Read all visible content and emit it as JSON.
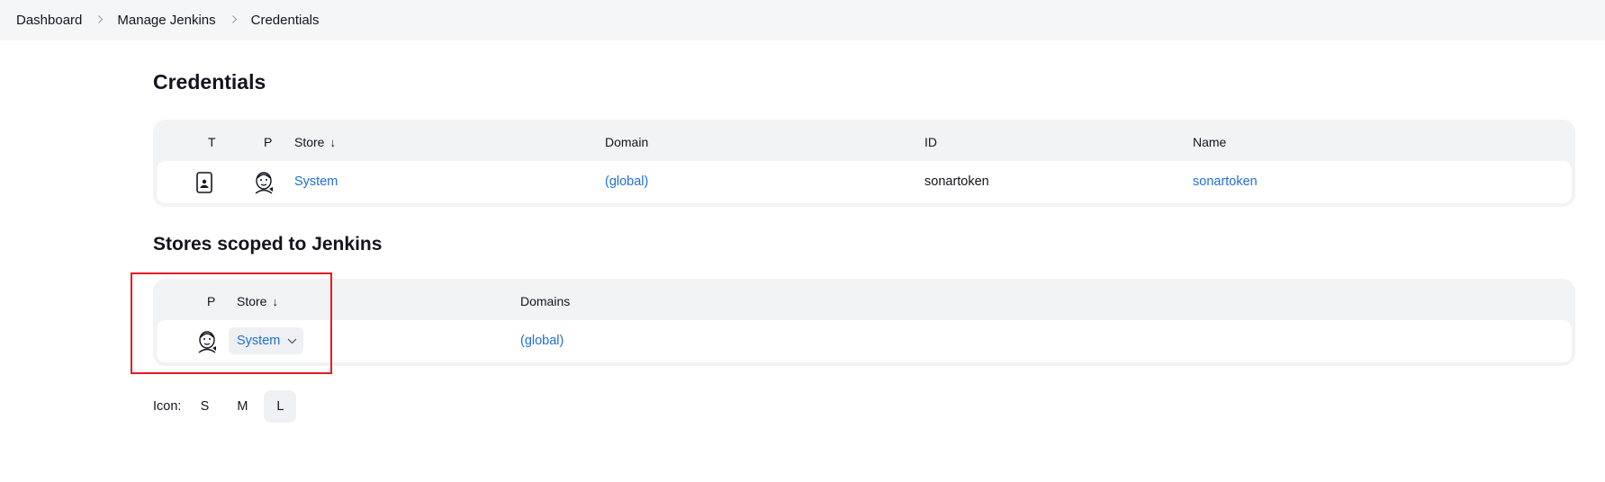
{
  "breadcrumb": {
    "items": [
      "Dashboard",
      "Manage Jenkins",
      "Credentials"
    ]
  },
  "credentials": {
    "title": "Credentials",
    "headers": {
      "t": "T",
      "p": "P",
      "store": "Store",
      "sort_arrow": "↓",
      "domain": "Domain",
      "id": "ID",
      "name": "Name"
    },
    "rows": [
      {
        "type_icon": "mobile-token-icon",
        "provider_icon": "jenkins-butler-icon",
        "store": "System",
        "domain": "(global)",
        "id": "sonartoken",
        "name": "sonartoken"
      }
    ]
  },
  "stores": {
    "title": "Stores scoped to Jenkins",
    "headers": {
      "p": "P",
      "store": "Store",
      "sort_arrow": "↓",
      "domains": "Domains"
    },
    "rows": [
      {
        "provider_icon": "jenkins-butler-icon",
        "store": "System",
        "domains": "(global)"
      }
    ]
  },
  "icon_size": {
    "label": "Icon:",
    "options": [
      "S",
      "M",
      "L"
    ],
    "selected": "L"
  },
  "colors": {
    "link": "#1f6fd6",
    "highlight": "#e51c23",
    "header_bg": "#f1f3f5"
  }
}
